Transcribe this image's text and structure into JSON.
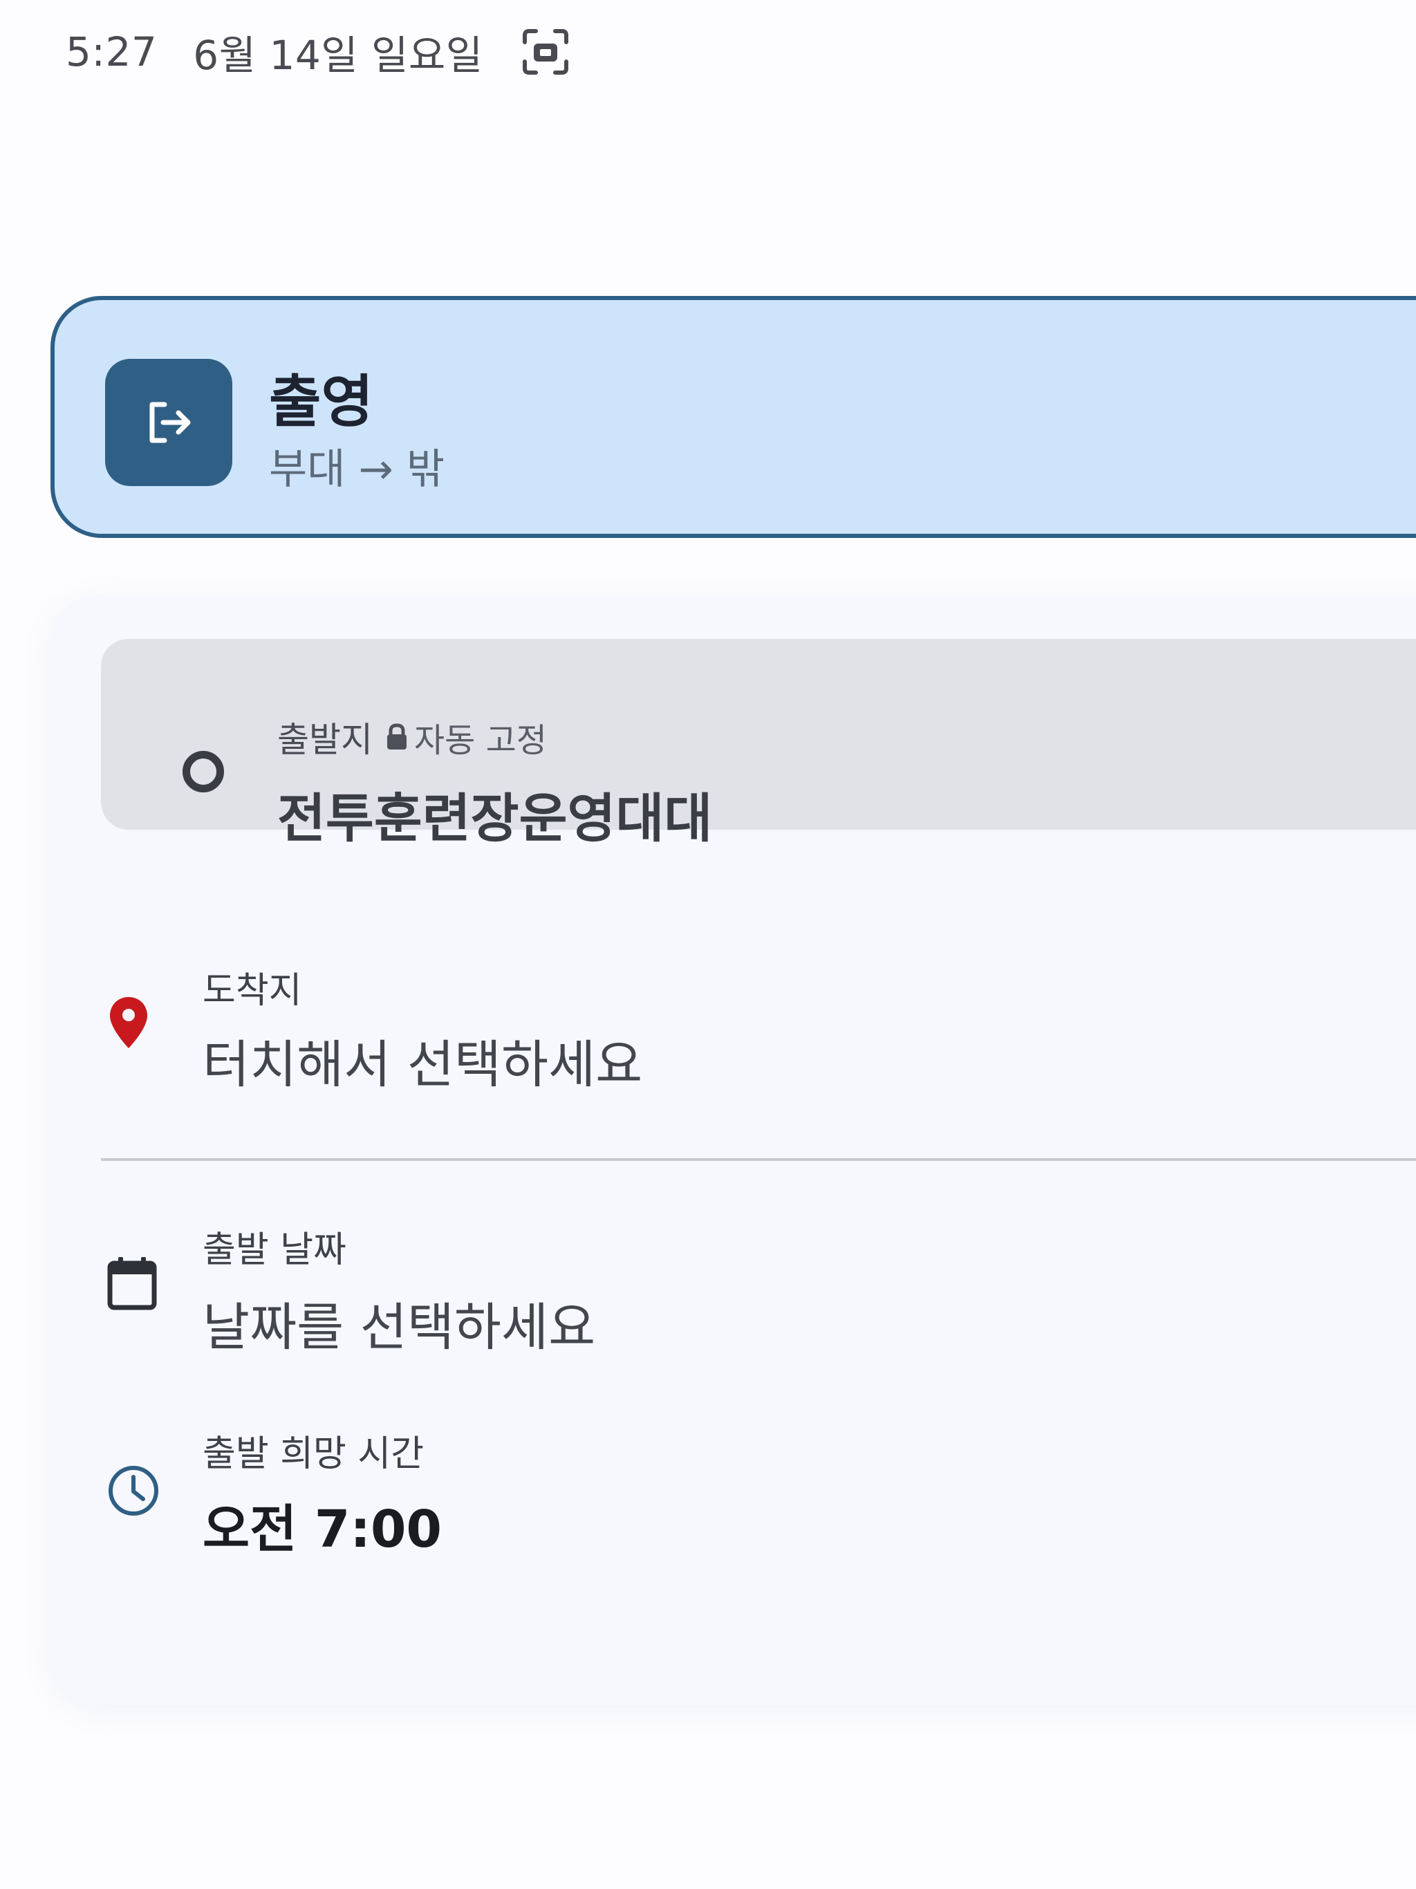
{
  "status_bar": {
    "time": "5:27",
    "date": "6월 14일 일요일",
    "screenshot_icon": "screenshot-icon"
  },
  "type_card": {
    "title": "출영",
    "subtitle": "부대 → 밖",
    "icon": "exit-icon",
    "colors": {
      "background": "#cde4fb",
      "border": "#2e5f86",
      "icon_background": "#2f5f84"
    }
  },
  "form": {
    "origin": {
      "label": "출발지",
      "lock_text": "자동 고정",
      "value": "전투훈련장운영대대",
      "icon": "origin-ring-icon"
    },
    "destination": {
      "label": "도착지",
      "placeholder": "터치해서 선택하세요",
      "icon": "location-pin-icon",
      "icon_color": "#c8191e"
    },
    "departure_date": {
      "label": "출발 날짜",
      "placeholder": "날짜를 선택하세요",
      "icon": "calendar-icon"
    },
    "departure_time": {
      "label": "출발 희망 시간",
      "value": "오전 7:00",
      "icon": "clock-icon",
      "icon_color": "#2f5f84"
    }
  }
}
